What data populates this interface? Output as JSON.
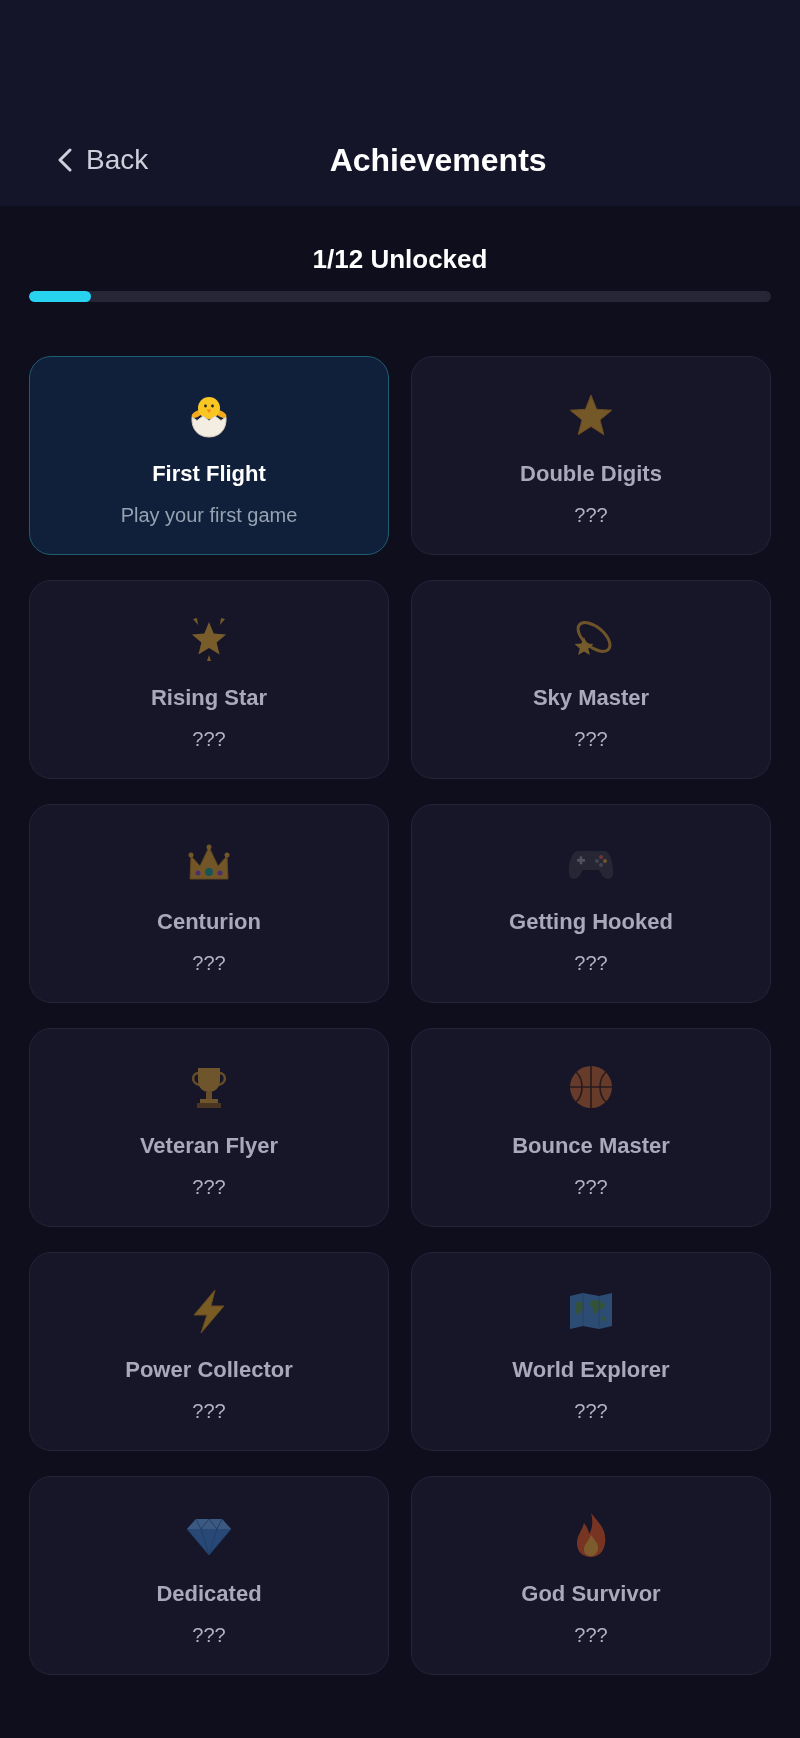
{
  "header": {
    "back_label": "Back",
    "title": "Achievements"
  },
  "progress": {
    "label": "1/12 Unlocked",
    "level": 0.083
  },
  "achievements": [
    {
      "kind": "chick",
      "title": "First Flight",
      "description": "Play your first game",
      "unlocked": true
    },
    {
      "kind": "star",
      "title": "Double Digits",
      "description": "???",
      "unlocked": false
    },
    {
      "kind": "glowing-star",
      "title": "Rising Star",
      "description": "???",
      "unlocked": false
    },
    {
      "kind": "orbit-star",
      "title": "Sky Master",
      "description": "???",
      "unlocked": false
    },
    {
      "kind": "crown",
      "title": "Centurion",
      "description": "???",
      "unlocked": false
    },
    {
      "kind": "gamepad",
      "title": "Getting Hooked",
      "description": "???",
      "unlocked": false
    },
    {
      "kind": "trophy",
      "title": "Veteran Flyer",
      "description": "???",
      "unlocked": false
    },
    {
      "kind": "basketball",
      "title": "Bounce Master",
      "description": "???",
      "unlocked": false
    },
    {
      "kind": "lightning",
      "title": "Power Collector",
      "description": "???",
      "unlocked": false
    },
    {
      "kind": "map",
      "title": "World Explorer",
      "description": "???",
      "unlocked": false
    },
    {
      "kind": "gem",
      "title": "Dedicated",
      "description": "???",
      "unlocked": false
    },
    {
      "kind": "fire",
      "title": "God Survivor",
      "description": "???",
      "unlocked": false
    }
  ]
}
